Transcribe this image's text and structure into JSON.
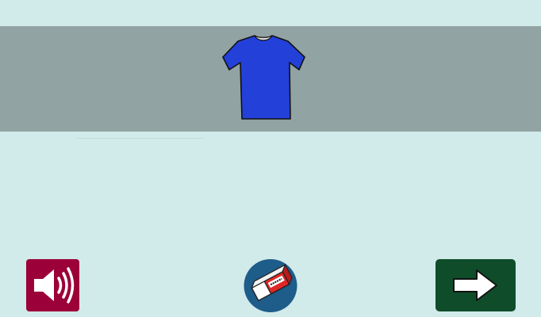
{
  "activity": {
    "picture": {
      "icon": "tshirt-icon",
      "color": "#2340d9"
    },
    "answer": {
      "value": ""
    }
  },
  "controls": {
    "audio": {
      "icon": "speaker-icon",
      "color": "#9b0038"
    },
    "clear": {
      "icon": "eraser-icon",
      "color": "#1e5c8a"
    },
    "next": {
      "icon": "arrow-right-icon",
      "color": "#0f4d2a"
    }
  }
}
